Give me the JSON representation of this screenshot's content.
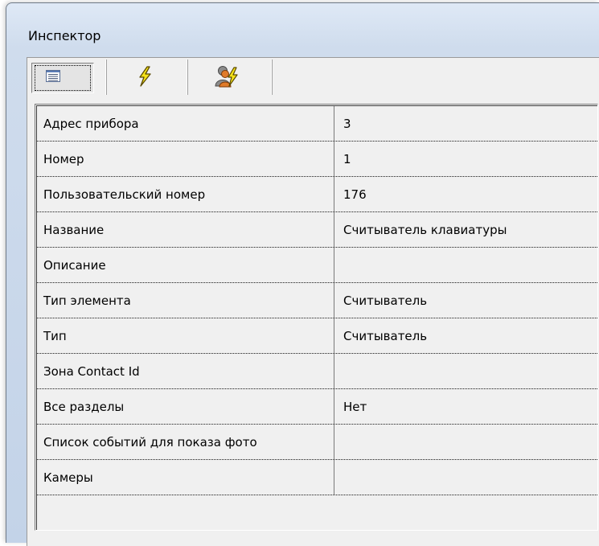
{
  "inspector": {
    "title": "Инспектор",
    "toolbar": {
      "buttons": [
        {
          "icon": "list-view-icon",
          "state": "pressed"
        },
        {
          "icon": "lightning-icon",
          "state": "normal"
        },
        {
          "icon": "users-lightning-icon",
          "state": "normal"
        }
      ]
    },
    "properties": [
      {
        "name": "Адрес прибора",
        "value": "3"
      },
      {
        "name": "Номер",
        "value": "1"
      },
      {
        "name": "Пользовательский номер",
        "value": "176"
      },
      {
        "name": "Название",
        "value": "Считыватель клавиатуры"
      },
      {
        "name": "Описание",
        "value": ""
      },
      {
        "name": "Тип элемента",
        "value": "Считыватель"
      },
      {
        "name": "Тип",
        "value": "Считыватель"
      },
      {
        "name": "Зона Contact Id",
        "value": ""
      },
      {
        "name": "Все разделы",
        "value": "Нет"
      },
      {
        "name": "Список событий для показа фото",
        "value": ""
      },
      {
        "name": "Камеры",
        "value": ""
      }
    ]
  },
  "colors": {
    "window_gradient_top": "#dfe9f6",
    "window_gradient_bottom": "#c3d3e8",
    "panel_bg": "#f0f0f0",
    "bolt_yellow": "#f5e21a"
  }
}
